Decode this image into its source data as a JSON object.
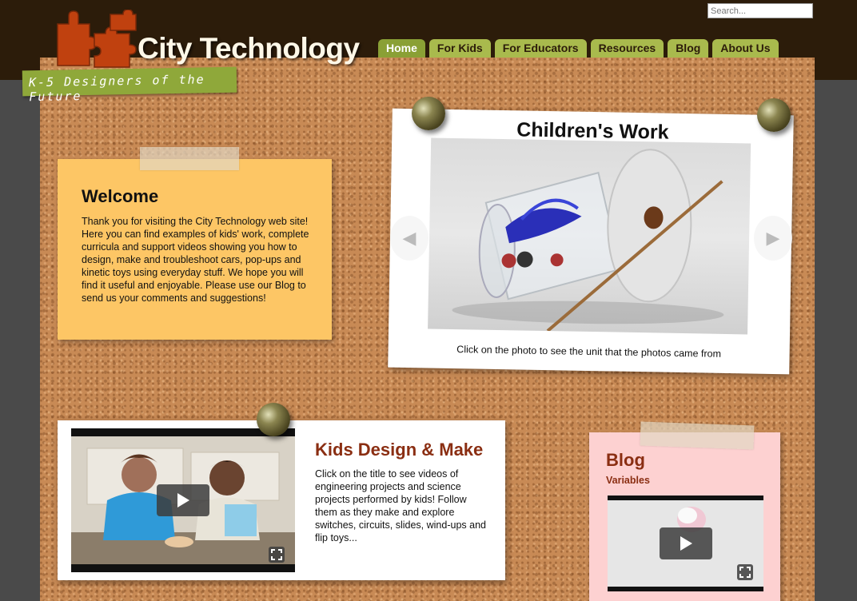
{
  "header": {
    "site_title": "City Technology",
    "tagline": "K-5 Designers of the Future",
    "search_placeholder": "Search..."
  },
  "nav": {
    "items": [
      "Home",
      "For Kids",
      "For Educators",
      "Resources",
      "Blog",
      "About Us"
    ],
    "active": "Home"
  },
  "welcome": {
    "title": "Welcome",
    "body": "Thank you for visiting the City Technology web site! Here you can find examples of kids' work, complete curricula and support videos showing you how to design, make and troubleshoot cars, pop-ups and kinetic toys using everyday stuff. We hope you will find it useful and enjoyable. Please use our Blog to send us your comments and suggestions!"
  },
  "children_work": {
    "title": "Children's Work",
    "caption": "Click on the photo to see the unit that the photos came from"
  },
  "kids_design": {
    "title": "Kids Design & Make",
    "body": "Click on the title to see videos of engineering projects and science projects performed by kids! Follow them as they make and explore switches, circuits, slides, wind-ups and flip toys..."
  },
  "blog": {
    "title": "Blog",
    "subtitle": "Variables"
  },
  "colors": {
    "header_bg": "#2c1c0a",
    "nav_tab": "#a9ba4d",
    "nav_active": "#8aa035",
    "welcome_note": "#fdc665",
    "blog_note": "#fdd1d1",
    "accent_red": "#8a2e12",
    "logo_orange": "#c0410f"
  }
}
